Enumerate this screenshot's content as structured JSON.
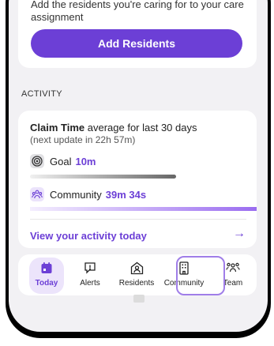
{
  "add_card": {
    "description": "Add the residents you're caring for to your care assignment",
    "button_label": "Add Residents"
  },
  "section_label": "ACTIVITY",
  "activity": {
    "claim_title_bold": "Claim Time",
    "claim_title_rest": " average for last 30 days",
    "claim_subtitle": "(next update in 22h 57m)",
    "goal_label": "Goal",
    "goal_value": "10m",
    "goal_progress": 0.6,
    "community_label": "Community",
    "community_value": "39m 34s",
    "community_progress": 1.0,
    "view_link": "View your activity today",
    "arrow": "→"
  },
  "tabs": [
    {
      "label": "Today",
      "icon": "calendar-icon",
      "selected": true
    },
    {
      "label": "Alerts",
      "icon": "alert-message-icon",
      "selected": false
    },
    {
      "label": "Residents",
      "icon": "residents-icon",
      "selected": false
    },
    {
      "label": "Community",
      "icon": "building-icon",
      "selected": false,
      "focused": true
    },
    {
      "label": "Team",
      "icon": "team-icon",
      "selected": false
    }
  ],
  "colors": {
    "accent": "#6c3fd6",
    "background": "#f2f1f4",
    "focus_ring": "#a07ee8"
  }
}
